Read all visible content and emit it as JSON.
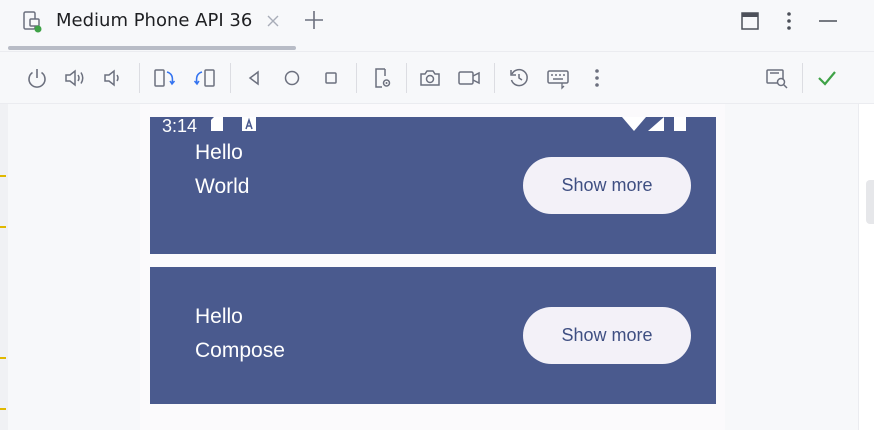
{
  "tabbar": {
    "tab_title": "Medium Phone API 36",
    "tab_icon": "device-mirroring-icon",
    "close_icon": "close-icon",
    "add_icon": "plus-icon"
  },
  "window_controls": [
    "maximize-window-icon",
    "more-vertical-icon",
    "minimize-icon"
  ],
  "toolbar": {
    "buttons": [
      "power-icon",
      "volume-up-icon",
      "volume-down-icon",
      "rotate-left-icon",
      "rotate-right-icon",
      "back-icon",
      "home-icon",
      "overview-icon",
      "device-settings-icon",
      "camera-icon",
      "video-record-icon",
      "reset-icon",
      "keyboard-icon",
      "more-vertical-icon",
      "device-explorer-icon",
      "checkmark-icon"
    ]
  },
  "device": {
    "status_time": "3:14",
    "cards": [
      {
        "line1": "Hello",
        "line2": "World",
        "button_label": "Show more"
      },
      {
        "line1": "Hello",
        "line2": "Compose",
        "button_label": "Show more"
      }
    ]
  },
  "colors": {
    "card_background": "#4a5a8e",
    "button_background": "#f3f1f8",
    "button_text": "#3f4f82",
    "check_green": "#3fa247"
  }
}
